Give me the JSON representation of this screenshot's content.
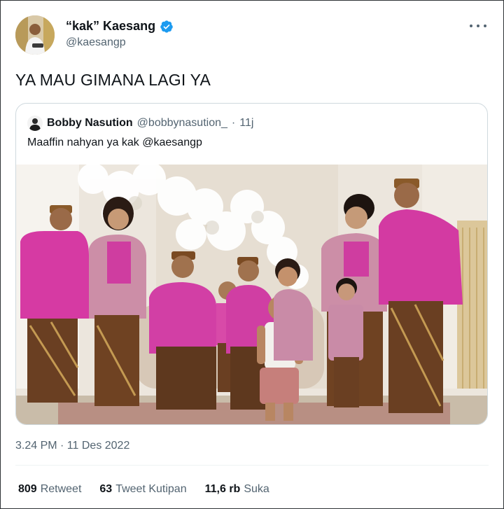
{
  "author": {
    "display_name": "“kak” Kaesang",
    "handle": "@kaesangp",
    "avatar_icon": "user-avatar",
    "verified": true
  },
  "menu": {
    "icon": "more-horizontal-icon"
  },
  "tweet": {
    "text": "YA MAU GIMANA LAGI YA"
  },
  "quoted_tweet": {
    "display_name": "Bobby Nasution",
    "handle": "@bobbynasution_",
    "separator": "·",
    "time": "11j",
    "text": "Maaffin nahyan ya kak @kaesangp",
    "photo_icon": "family-photo"
  },
  "meta": {
    "timestamp": "3.24 PM · 11 Des 2022"
  },
  "stats": [
    {
      "value": "809",
      "label": "Retweet"
    },
    {
      "value": "63",
      "label": "Tweet Kutipan"
    },
    {
      "value": "11,6 rb",
      "label": "Suka"
    }
  ],
  "colors": {
    "text_primary": "#0f1419",
    "text_secondary": "#536471",
    "verified_blue": "#1d9bf0",
    "border": "#cfd9de"
  }
}
